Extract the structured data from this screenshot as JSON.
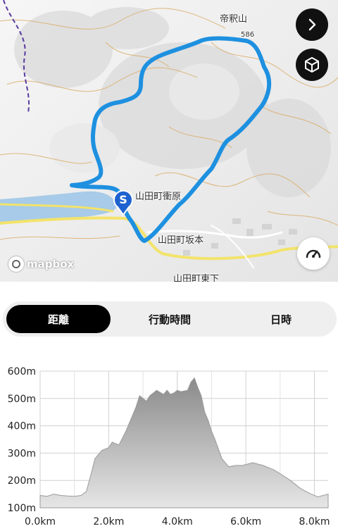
{
  "map": {
    "labels": {
      "peak": "帝釈山",
      "elevation": "586",
      "town1": "山田町衝原",
      "town2": "山田町坂本",
      "town3": "山田町東下"
    },
    "start_marker": "S",
    "attribution": "mapbox",
    "route_color": "#1e90e0",
    "buttons": {
      "next": "chevron-right-icon",
      "view3d": "cube-icon",
      "speed": "speedometer-icon"
    }
  },
  "tabs": [
    {
      "label": "距離",
      "active": true
    },
    {
      "label": "行動時間",
      "active": false
    },
    {
      "label": "日時",
      "active": false
    }
  ],
  "chart_data": {
    "type": "area",
    "xlabel": "",
    "ylabel": "",
    "xlim": [
      0,
      8.4
    ],
    "ylim": [
      100,
      600
    ],
    "x_ticks": [
      "0.0km",
      "2.0km",
      "4.0km",
      "6.0km",
      "8.0km"
    ],
    "y_ticks": [
      "600m",
      "500m",
      "400m",
      "300m",
      "200m",
      "100m"
    ],
    "grid": true,
    "series": [
      {
        "x": [
          0,
          0.2,
          0.4,
          0.6,
          0.8,
          1.0,
          1.2,
          1.35,
          1.5,
          1.6,
          1.8,
          2.0,
          2.1,
          2.3,
          2.5,
          2.7,
          2.8,
          2.9,
          3.0,
          3.1,
          3.2,
          3.4,
          3.6,
          3.7,
          3.8,
          3.9,
          4.0,
          4.1,
          4.3,
          4.4,
          4.5,
          4.6,
          4.7,
          4.8,
          4.9,
          5.0,
          5.1,
          5.3,
          5.5,
          5.7,
          5.9,
          6.2,
          6.5,
          6.8,
          7.0,
          7.3,
          7.6,
          7.9,
          8.1,
          8.4
        ],
        "y": [
          145,
          142,
          150,
          145,
          143,
          142,
          145,
          160,
          230,
          280,
          310,
          320,
          340,
          330,
          380,
          440,
          470,
          510,
          500,
          490,
          510,
          530,
          515,
          530,
          515,
          520,
          530,
          525,
          530,
          560,
          575,
          540,
          510,
          450,
          420,
          380,
          350,
          280,
          250,
          255,
          255,
          265,
          255,
          240,
          225,
          200,
          170,
          150,
          140,
          150
        ]
      }
    ]
  }
}
